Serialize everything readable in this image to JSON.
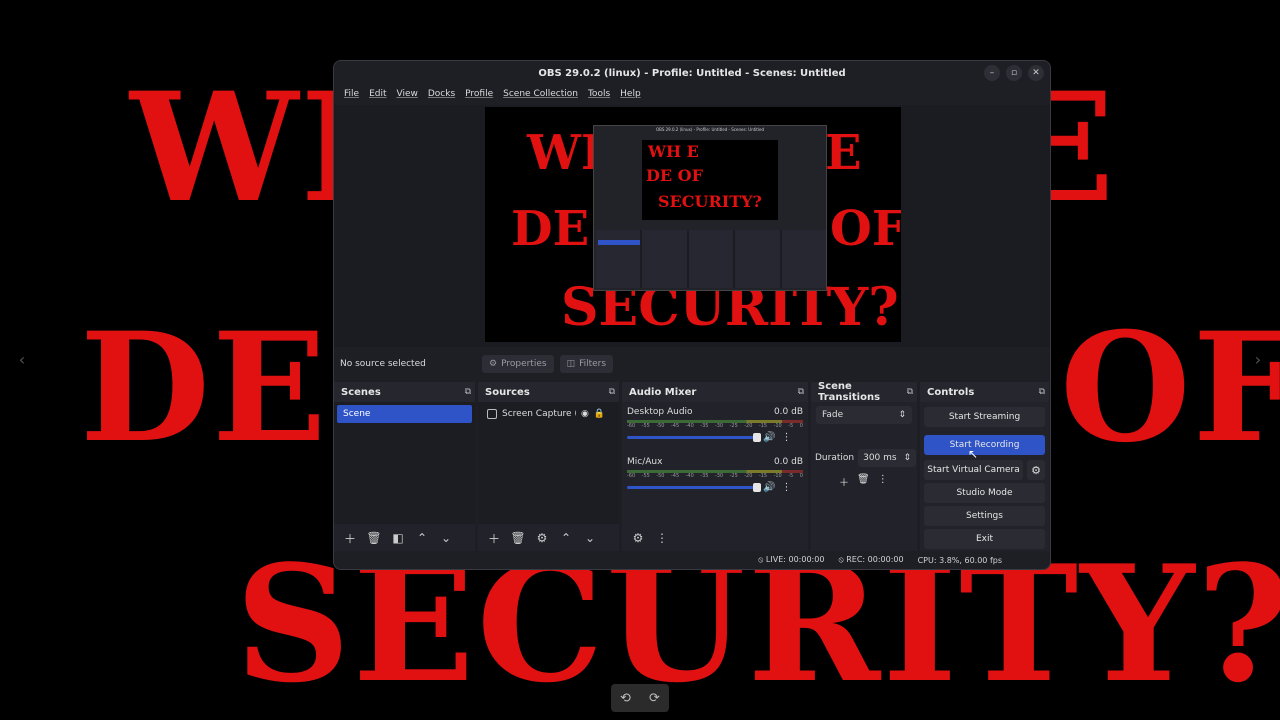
{
  "background": {
    "line1_left": "WH",
    "line1_right": "E",
    "line2_left": "DEF",
    "line2_right": "OF",
    "line3": "SECURITY?"
  },
  "window": {
    "title": "OBS 29.0.2 (linux) - Profile: Untitled - Scenes: Untitled",
    "controls": {
      "minimize": "–",
      "maximize": "▫",
      "close": "✕"
    }
  },
  "menu": [
    "File",
    "Edit",
    "View",
    "Docks",
    "Profile",
    "Scene Collection",
    "Tools",
    "Help"
  ],
  "preview": {
    "line1_left": "WH",
    "line1_right": "E",
    "line2_left": "DE",
    "line2_right": "OF",
    "line3": "SECURITY?",
    "nested_title": "OBS 29.0.2 (linux) - Profile: Untitled - Scenes: Untitled",
    "nested_l1": "WH   E",
    "nested_l2": "DE    OF",
    "nested_l3": "SECURITY?"
  },
  "source_bar": {
    "no_source": "No source selected",
    "properties": "Properties",
    "filters": "Filters"
  },
  "scenes": {
    "title": "Scenes",
    "items": [
      "Scene"
    ]
  },
  "sources": {
    "title": "Sources",
    "items": [
      "Screen Capture (Pi"
    ]
  },
  "audio_mixer": {
    "title": "Audio Mixer",
    "channels": [
      {
        "name": "Desktop Audio",
        "level": "0.0 dB"
      },
      {
        "name": "Mic/Aux",
        "level": "0.0 dB"
      }
    ],
    "ticks": [
      "-60",
      "-55",
      "-50",
      "-45",
      "-40",
      "-35",
      "-30",
      "-25",
      "-20",
      "-15",
      "-10",
      "-5",
      "0"
    ]
  },
  "transitions": {
    "title": "Scene Transitions",
    "selected": "Fade",
    "duration_label": "Duration",
    "duration_value": "300 ms"
  },
  "controls": {
    "title": "Controls",
    "start_streaming": "Start Streaming",
    "start_recording": "Start Recording",
    "start_virtual_camera": "Start Virtual Camera",
    "studio_mode": "Studio Mode",
    "settings": "Settings",
    "exit": "Exit"
  },
  "status": {
    "live": "LIVE: 00:00:00",
    "rec": "REC: 00:00:00",
    "cpu": "CPU: 3.8%, 60.00 fps"
  },
  "colors": {
    "accent": "#2f54c8",
    "background_text": "#e11111",
    "panel": "#22232a"
  }
}
